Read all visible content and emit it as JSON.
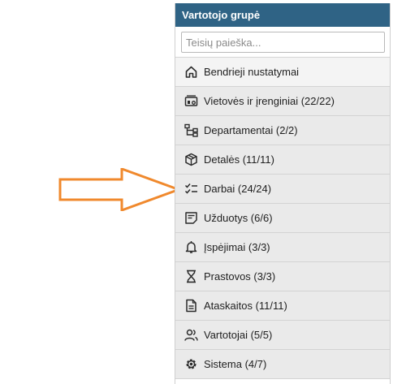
{
  "panel": {
    "title": "Vartotojo grupė",
    "search_placeholder": "Teisių paieška..."
  },
  "menu": {
    "items": [
      {
        "label": "Bendrieji nustatymai",
        "icon": "home-icon"
      },
      {
        "label": "Vietovės ir įrenginiai (22/22)",
        "icon": "locations-devices-icon"
      },
      {
        "label": "Departamentai (2/2)",
        "icon": "org-chart-icon"
      },
      {
        "label": "Detalės (11/11)",
        "icon": "box-icon"
      },
      {
        "label": "Darbai (24/24)",
        "icon": "checklist-icon"
      },
      {
        "label": "Užduotys (6/6)",
        "icon": "task-note-icon"
      },
      {
        "label": "Įspėjimai (3/3)",
        "icon": "bell-icon"
      },
      {
        "label": "Prastovos (3/3)",
        "icon": "hourglass-icon"
      },
      {
        "label": "Ataskaitos (11/11)",
        "icon": "document-icon"
      },
      {
        "label": "Vartotojai (5/5)",
        "icon": "users-icon"
      },
      {
        "label": "Sistema (4/7)",
        "icon": "gear-icon"
      }
    ]
  },
  "colors": {
    "header_bg": "#2f6385",
    "arrow": "#f0892d",
    "item_bg": "#eaeaea",
    "active_item_bg": "#f4f4f4"
  }
}
